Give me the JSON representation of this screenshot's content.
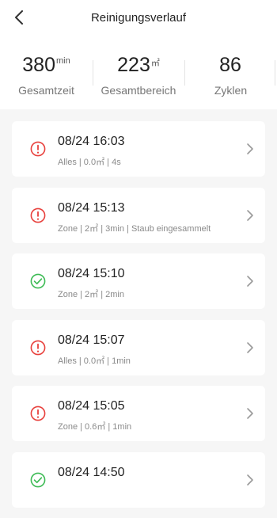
{
  "header": {
    "title": "Reinigungsverlauf"
  },
  "stats": [
    {
      "value": "380",
      "unit": "min",
      "label": "Gesamtzeit"
    },
    {
      "value": "223",
      "unit": "㎡",
      "label": "Gesamtbereich"
    },
    {
      "value": "86",
      "unit": "",
      "label": "Zyklen"
    }
  ],
  "records": [
    {
      "title": "08/24 16:03",
      "detail": "Alles | 0.0㎡ | 4s",
      "status": "error"
    },
    {
      "title": "08/24 15:13",
      "detail": "Zone | 2㎡ | 3min | Staub eingesammelt",
      "status": "error"
    },
    {
      "title": "08/24 15:10",
      "detail": "Zone | 2㎡ | 2min",
      "status": "success"
    },
    {
      "title": "08/24 15:07",
      "detail": "Alles | 0.0㎡ | 1min",
      "status": "error"
    },
    {
      "title": "08/24 15:05",
      "detail": "Zone | 0.6㎡ | 1min",
      "status": "error"
    },
    {
      "title": "08/24 14:50",
      "detail": "",
      "status": "success"
    }
  ],
  "colors": {
    "error": "#e8403c",
    "success": "#3dbb55"
  },
  "icons": {
    "back": "back-arrow-icon",
    "chevron": "chevron-right-icon",
    "error": "error-circle-icon",
    "success": "check-circle-icon"
  }
}
